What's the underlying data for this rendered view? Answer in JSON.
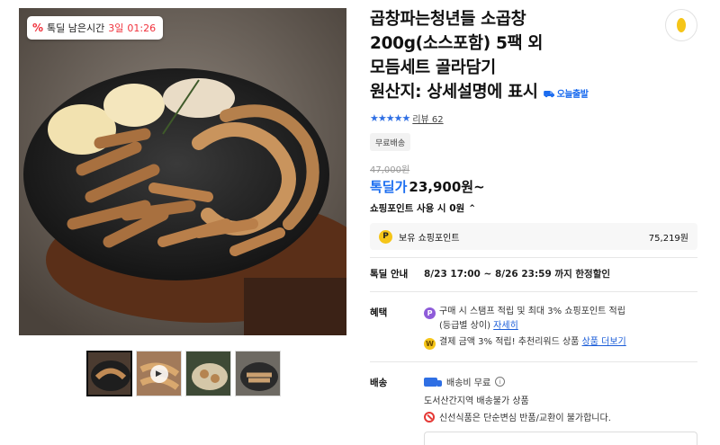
{
  "timer": {
    "label": "톡딜 남은시간",
    "days": "3일",
    "time": "01:26",
    "icon": "discount-percent-icon"
  },
  "gallery": {
    "thumbnails": [
      "thumb-1",
      "thumb-2-video",
      "thumb-3",
      "thumb-4"
    ]
  },
  "product": {
    "title_lines": [
      "곱창파는청년들 소곱창",
      "200g(소스포함) 5팩 외",
      "모듬세트 골라담기",
      "원산지: 상세설명에 표시"
    ],
    "delivery_badge": "오늘출발",
    "review_label": "리뷰 62",
    "free_shipping": "무료배송",
    "original_price": "47,000원",
    "deal_label": "톡딜가",
    "deal_price": "23,900원~",
    "point_use": "쇼핑포인트 사용 시 0원"
  },
  "points": {
    "label": "보유 쇼핑포인트",
    "value": "75,219원",
    "coin": "P"
  },
  "deal_info": {
    "label": "톡딜 안내",
    "period": "8/23 17:00 ~ 8/26 23:59 까지 한정할인"
  },
  "benefits": {
    "label": "혜택",
    "line1": "구매 시 스탬프 적립 및 최대 3% 쇼핑포인트 적립",
    "line2_prefix": "(등급별 상이)",
    "line2_link": "자세히",
    "line3": "결제 금액 3% 적립! 추천리워드 상품",
    "line3_link": "상품 더보기"
  },
  "shipping": {
    "label": "배송",
    "fee": "배송비 무료",
    "area": "도서산간지역 배송불가 상품",
    "notice": "신선식품은 단순변심 반품/교환이 불가합니다."
  },
  "colors": {
    "accent_blue": "#1b6ef0",
    "timer_red": "#f0323c",
    "point_yellow": "#f5c518"
  }
}
